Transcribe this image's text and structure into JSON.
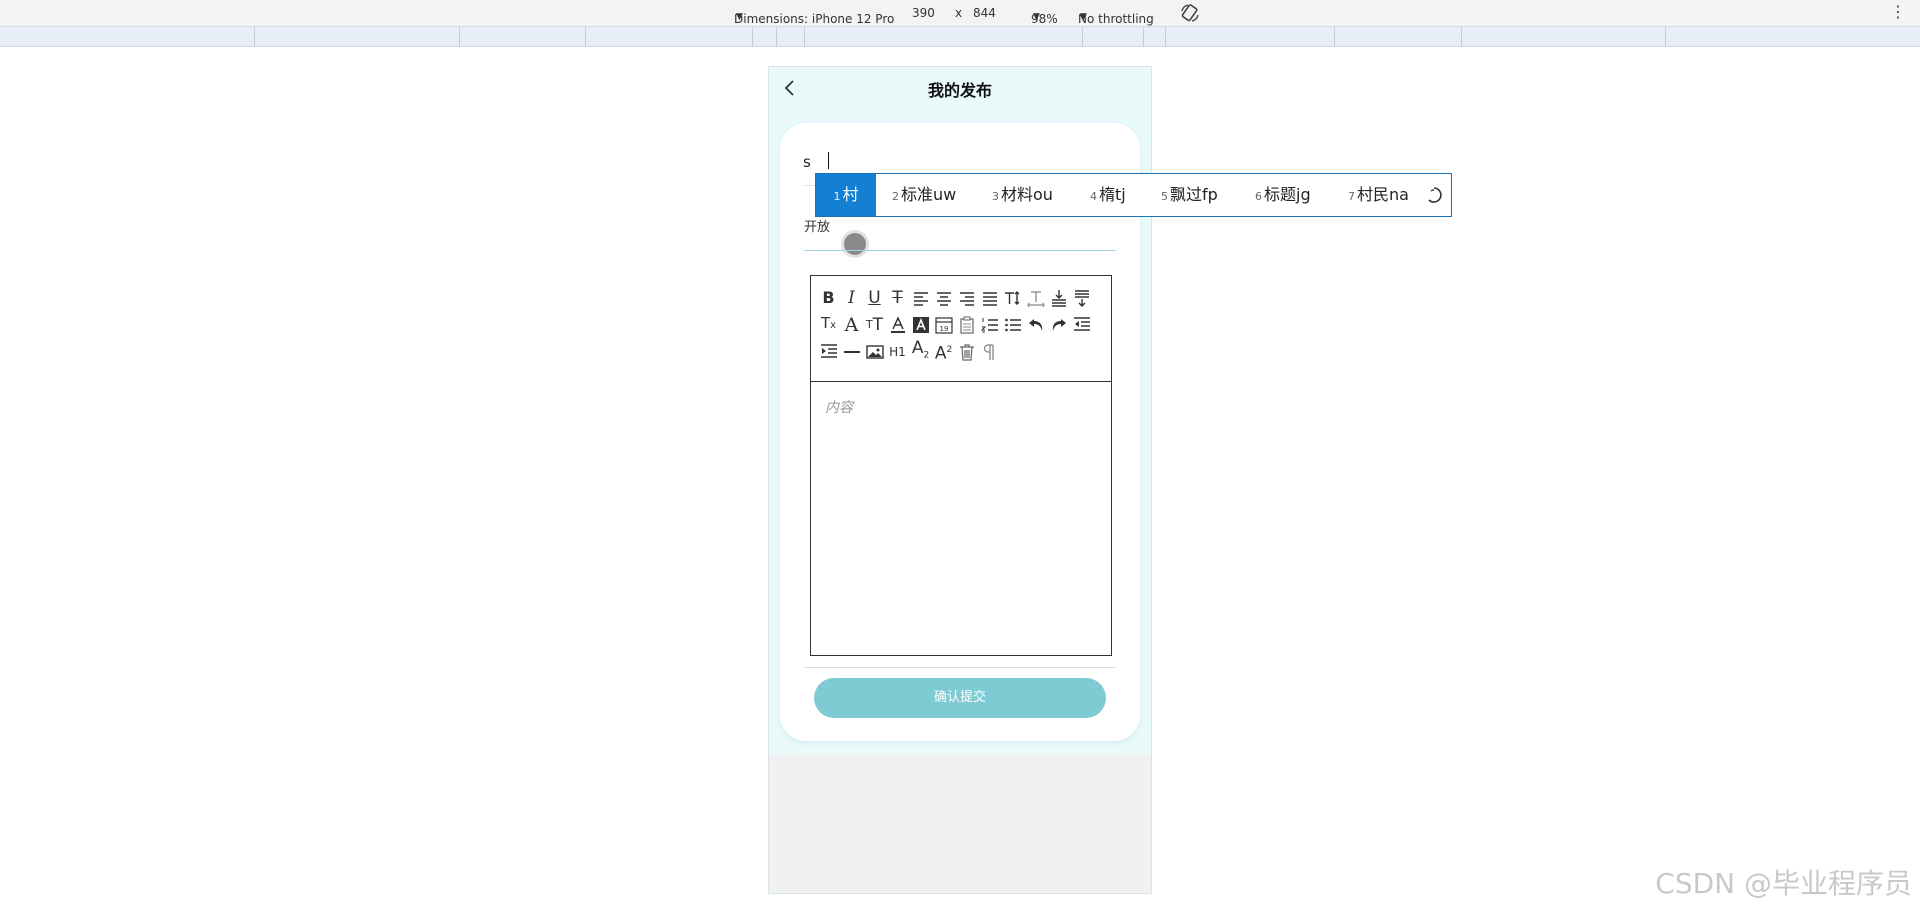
{
  "devtools": {
    "dimensions_label": "Dimensions: iPhone 12 Pro",
    "width": "390",
    "times": "x",
    "height": "844",
    "zoom": "98%",
    "throttling": "No throttling"
  },
  "page": {
    "title": "我的发布",
    "title_input_value": "s",
    "switch_label": "开放",
    "editor_placeholder": "内容",
    "submit_label": "确认提交"
  },
  "toolbar": {
    "rows": [
      [
        "bold-icon",
        "italic-icon",
        "underline-icon",
        "strikethrough-icon",
        "align-left-icon",
        "align-center-icon",
        "align-right-icon",
        "align-justify-icon",
        "line-height-icon",
        "letter-spacing-icon",
        "margin-top-icon",
        "margin-bottom-icon"
      ],
      [
        "clear-format-icon",
        "font-family-icon",
        "font-size-icon",
        "font-color-icon",
        "background-color-icon",
        "date-icon",
        "clipboard-icon",
        "ordered-list-icon",
        "bullet-list-icon",
        "undo-icon",
        "redo-icon",
        "outdent-icon"
      ],
      [
        "indent-icon",
        "horizontal-rule-icon",
        "image-icon",
        "header-icon",
        "subscript-icon",
        "superscript-icon",
        "delete-icon",
        "paragraph-icon"
      ]
    ],
    "header_label": "H1"
  },
  "ime": {
    "candidates": [
      {
        "n": "1",
        "text": "村"
      },
      {
        "n": "2",
        "text": "标准uw"
      },
      {
        "n": "3",
        "text": "材料ou"
      },
      {
        "n": "4",
        "text": "楕tj"
      },
      {
        "n": "5",
        "text": "飘过fp"
      },
      {
        "n": "6",
        "text": "标题jg"
      },
      {
        "n": "7",
        "text": "村民na"
      }
    ],
    "selected_index": 0
  },
  "watermark": "CSDN @毕业程序员",
  "colors": {
    "accent": "#7ecbd4",
    "ime_selected": "#1380d4",
    "page_bg": "#eafafb"
  }
}
